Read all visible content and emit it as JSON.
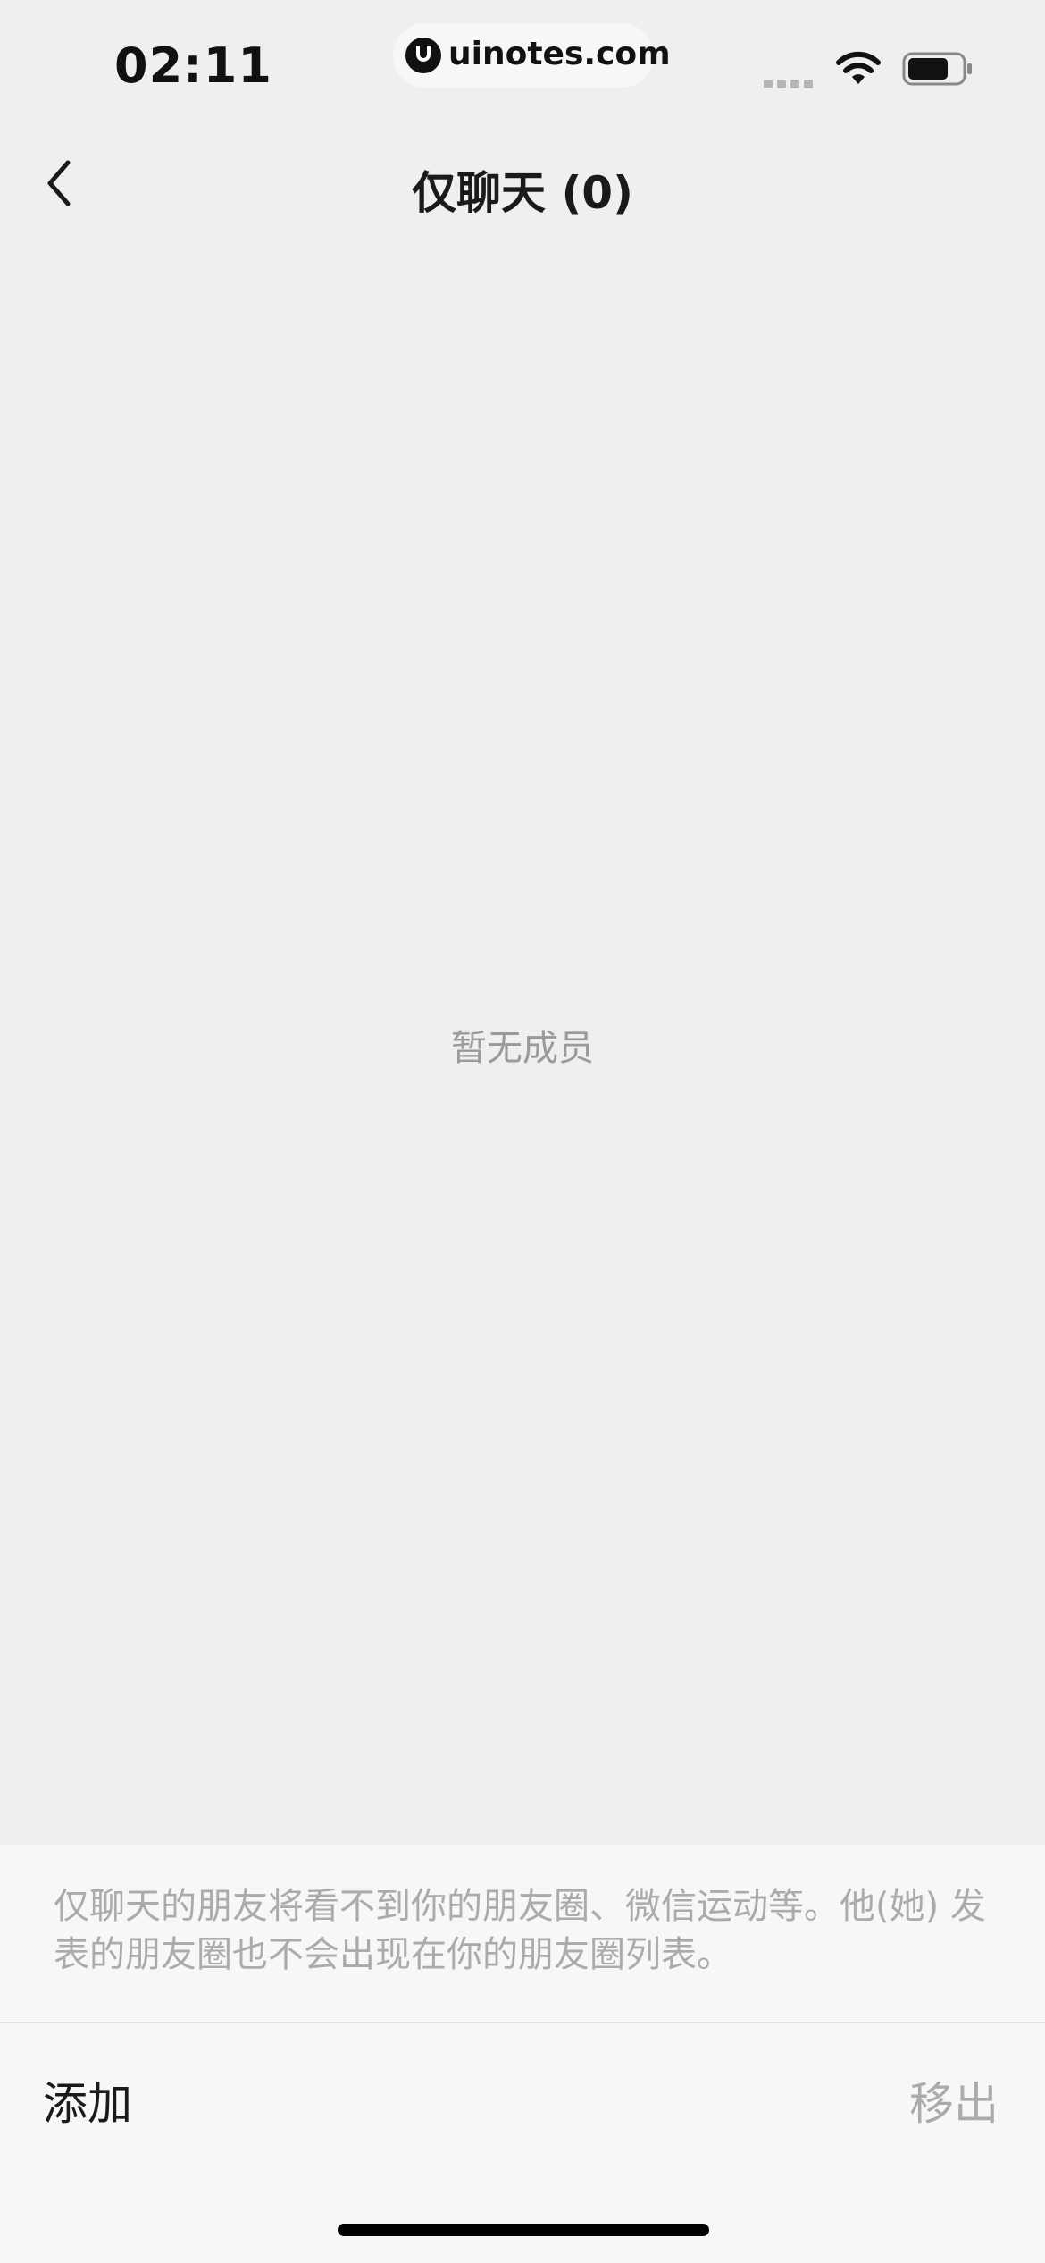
{
  "status_bar": {
    "time": "02:11",
    "watermark": "uinotes.com",
    "icons": [
      "signal-dots-icon",
      "wifi-icon",
      "battery-icon"
    ]
  },
  "nav": {
    "title": "仅聊天 (0)",
    "back_icon": "chevron-left-icon"
  },
  "main": {
    "empty_text": "暂无成员"
  },
  "bottom": {
    "note": "仅聊天的朋友将看不到你的朋友圈、微信运动等。他(她) 发表的朋友圈也不会出现在你的朋友圈列表。",
    "add_label": "添加",
    "remove_label": "移出"
  },
  "colors": {
    "background": "#EFEFEF",
    "panel": "#F7F7F7",
    "muted_text": "#ABABAB",
    "primary_text": "#1A1A1A"
  }
}
